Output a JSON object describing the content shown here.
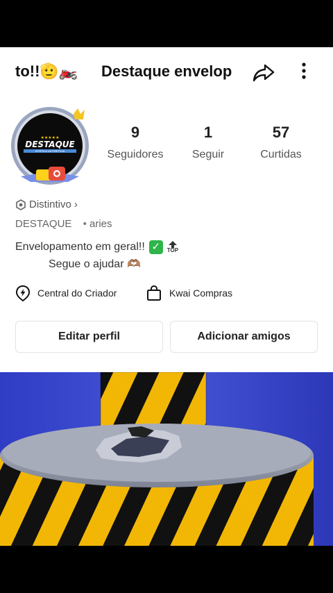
{
  "header": {
    "left_title": "to!!🫡🏍️",
    "title": "Destaque envelop"
  },
  "avatar": {
    "brand": "DESTAQUE",
    "tagline": "ESTÉTICA AUTOMOTIVA",
    "stars": "★★★★★"
  },
  "stats": [
    {
      "value": "9",
      "label": "Seguidores"
    },
    {
      "value": "1",
      "label": "Seguir"
    },
    {
      "value": "57",
      "label": "Curtidas"
    }
  ],
  "badge": {
    "label": "Distintivo",
    "chevron": "›"
  },
  "user": {
    "name": "DESTAQUE",
    "separator": "•",
    "sign": "aries"
  },
  "bio": {
    "line1": "Envelopamento em geral!!",
    "top_label": "TOP",
    "line2": "Segue o ajudar 🫶🏽"
  },
  "links": {
    "creator": "Central do Criador",
    "shopping": "Kwai Compras"
  },
  "buttons": {
    "edit": "Editar perfil",
    "add": "Adicionar amigos"
  },
  "colors": {
    "hazard_yellow": "#f2b705",
    "hazard_black": "#111111",
    "video_bg": "#3e4fd1",
    "check_green": "#2fb54a"
  }
}
